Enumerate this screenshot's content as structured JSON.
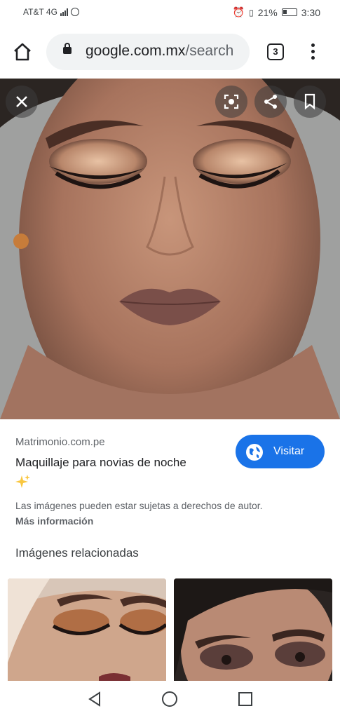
{
  "status_bar": {
    "carrier": "AT&T 4G",
    "battery": "21%",
    "time": "3:30"
  },
  "browser": {
    "url_domain": "google.com.mx",
    "url_path": "/search",
    "tab_count": "3"
  },
  "result": {
    "source": "Matrimonio.com.pe",
    "title": "Maquillaje para novias de noche",
    "visit_label": "Visitar",
    "copyright_notice": "Las imágenes pueden estar sujetas a derechos de autor.",
    "more_info": "Más información"
  },
  "related": {
    "heading": "Imágenes relacionadas"
  },
  "colors": {
    "accent": "#1a73e8",
    "sparkle": "#f9c740"
  },
  "icons": [
    "home-icon",
    "lock-icon",
    "tabs-icon",
    "more-vert-icon",
    "close-icon",
    "lens-icon",
    "share-icon",
    "bookmark-icon",
    "globe-icon",
    "sparkle-icon",
    "back-icon",
    "home-circle-icon",
    "recents-icon"
  ]
}
